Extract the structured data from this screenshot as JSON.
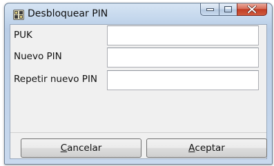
{
  "window": {
    "title": "Desbloquear PIN",
    "icon": "smartcard-app-icon"
  },
  "caption_buttons": {
    "minimize": "minimize-icon",
    "maximize": "maximize-icon",
    "close": "close-icon"
  },
  "form": {
    "fields": [
      {
        "label": "PUK",
        "value": ""
      },
      {
        "label": "Nuevo PIN",
        "value": ""
      },
      {
        "label": "Repetir nuevo PIN",
        "value": ""
      }
    ]
  },
  "buttons": {
    "cancel": {
      "mnemonic": "C",
      "rest": "ancelar"
    },
    "accept": {
      "mnemonic": "A",
      "rest": "ceptar"
    }
  }
}
